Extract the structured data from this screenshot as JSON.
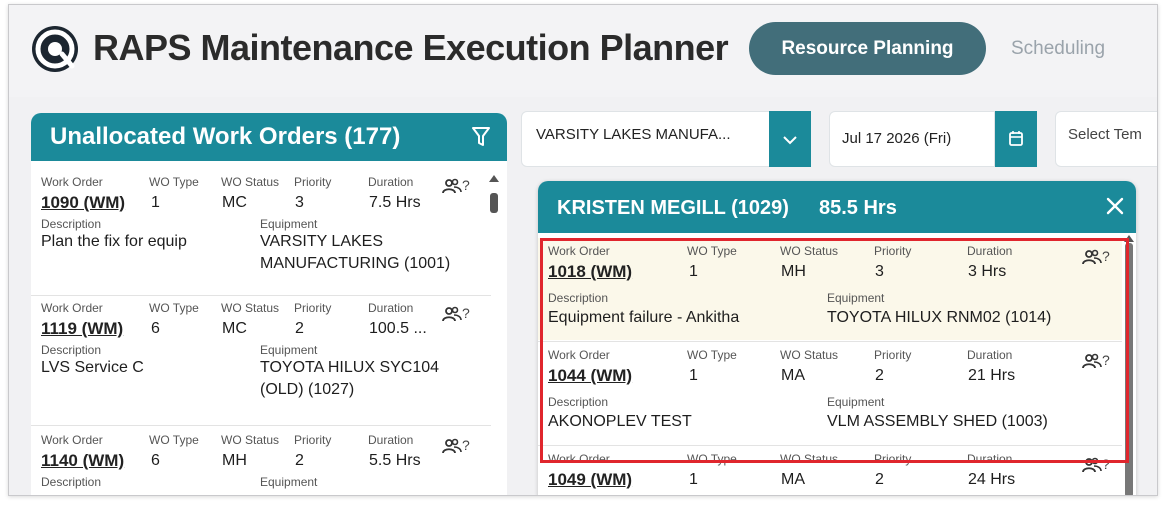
{
  "app": {
    "title": "RAPS Maintenance Execution Planner",
    "tabs": [
      {
        "label": "Resource Planning",
        "active": true
      },
      {
        "label": "Scheduling",
        "active": false
      }
    ]
  },
  "colors": {
    "accent": "#1b8a9a",
    "tab_active": "#426e7a",
    "highlight": "#e0262d",
    "card_highlight": "#fbf8ea"
  },
  "unallocated": {
    "title": "Unallocated Work Orders (177)",
    "filter_icon": "filter-icon",
    "labels": {
      "work_order": "Work Order",
      "wo_type": "WO Type",
      "wo_status": "WO Status",
      "priority": "Priority",
      "duration": "Duration",
      "description": "Description",
      "equipment": "Equipment"
    },
    "items": [
      {
        "work_order": "1090 (WM)",
        "wo_type": "1",
        "wo_status": "MC",
        "priority": "3",
        "duration": "7.5 Hrs",
        "resource": "?",
        "description": "Plan the fix for equip",
        "equipment_line1": "VARSITY LAKES",
        "equipment_line2": "MANUFACTURING (1001)"
      },
      {
        "work_order": "1119 (WM)",
        "wo_type": "6",
        "wo_status": "MC",
        "priority": "2",
        "duration": "100.5 ...",
        "resource": "?",
        "description": "LVS Service C",
        "equipment_line1": "TOYOTA HILUX SYC104",
        "equipment_line2": "(OLD) (1027)"
      },
      {
        "work_order": "1140 (WM)",
        "wo_type": "6",
        "wo_status": "MH",
        "priority": "2",
        "duration": "5.5 Hrs",
        "resource": "?",
        "description": "",
        "equipment_line1": "",
        "equipment_line2": ""
      }
    ]
  },
  "filters": {
    "site": "VARSITY LAKES MANUFA...",
    "date": "Jul 17 2026 (Fri)",
    "template_placeholder": "Select Tem"
  },
  "resource": {
    "name": "KRISTEN MEGILL (1029)",
    "hours": "85.5 Hrs",
    "items": [
      {
        "work_order": "1018 (WM)",
        "wo_type": "1",
        "wo_status": "MH",
        "priority": "3",
        "duration": "3 Hrs",
        "resource": "?",
        "description": "Equipment failure - Ankitha",
        "equipment": "TOYOTA HILUX RNM02 (1014)"
      },
      {
        "work_order": "1044 (WM)",
        "wo_type": "1",
        "wo_status": "MA",
        "priority": "2",
        "duration": "21 Hrs",
        "resource": "?",
        "description": "AKONOPLEV TEST",
        "equipment": "VLM ASSEMBLY SHED (1003)"
      },
      {
        "work_order": "1049 (WM)",
        "wo_type": "1",
        "wo_status": "MA",
        "priority": "2",
        "duration": "24 Hrs",
        "resource": "?",
        "description": "",
        "equipment": ""
      }
    ]
  }
}
